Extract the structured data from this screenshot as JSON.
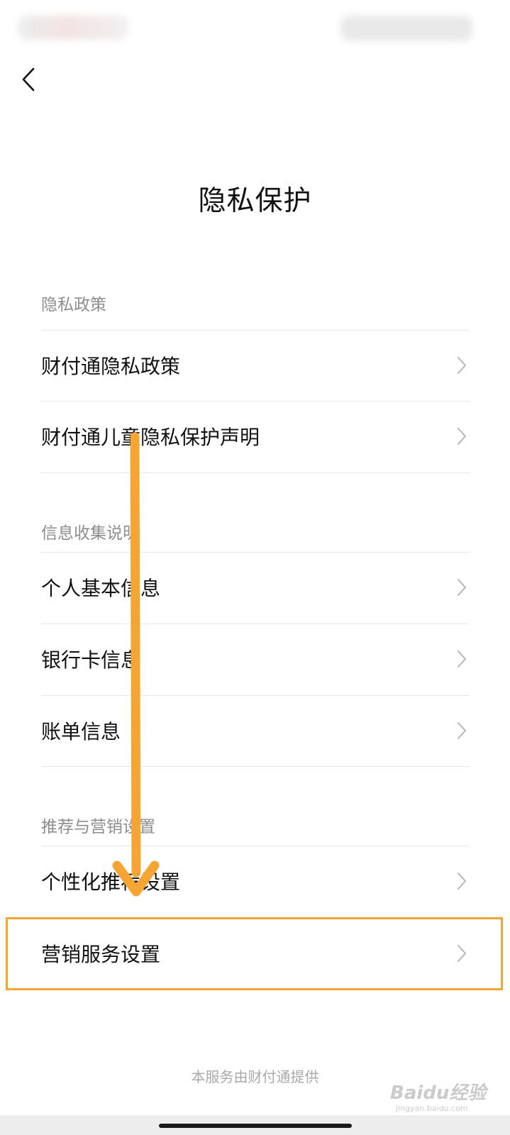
{
  "header": {
    "title": "隐私保护"
  },
  "sections": [
    {
      "title": "隐私政策",
      "items": [
        {
          "label": "财付通隐私政策"
        },
        {
          "label": "财付通儿童隐私保护声明"
        }
      ]
    },
    {
      "title": "信息收集说明",
      "items": [
        {
          "label": "个人基本信息"
        },
        {
          "label": "银行卡信息"
        },
        {
          "label": "账单信息"
        }
      ]
    },
    {
      "title": "推荐与营销设置",
      "items": [
        {
          "label": "个性化推荐设置"
        },
        {
          "label": "营销服务设置"
        }
      ]
    }
  ],
  "footer": {
    "text": "本服务由财付通提供"
  },
  "watermark": {
    "main": "Baidu经验",
    "sub": "jingyan.baidu.com"
  },
  "icons": {
    "back": "chevron-left-icon",
    "row_arrow": "chevron-right-icon"
  },
  "colors": {
    "annotation": "#f5a533",
    "section_header": "#8d8d8d",
    "footer": "#a9a9a9"
  }
}
